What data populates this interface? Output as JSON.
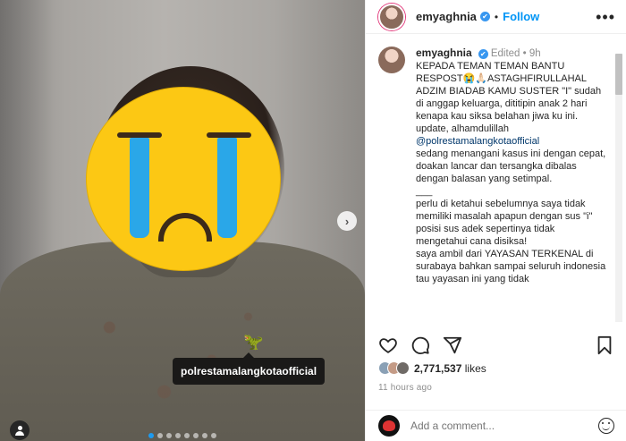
{
  "post": {
    "username": "emyaghnia",
    "follow_label": "Follow",
    "more_label": "•••",
    "separator": "•"
  },
  "caption": {
    "username": "emyaghnia",
    "meta": "Edited • 9h",
    "lines": [
      "KEPADA TEMAN TEMAN BANTU RESPOST😭🙏🏻ASTAGHFIRULLAHAL ADZIM BIADAB KAMU SUSTER \"I\" sudah di anggap keluarga, dititipin anak 2 hari kenapa kau siksa belahan jiwa ku ini.",
      "update, alhamdulillah",
      "@polrestamalangkotaofficial",
      "sedang menangani kasus ini dengan cepat, doakan lancar dan tersangka dibalas dengan balasan yang setimpal.",
      "___",
      "perlu di ketahui sebelumnya saya tidak memiliki masalah apapun dengan sus \"i\" posisi sus adek sepertinya tidak mengetahui cana disiksa!",
      "saya ambil dari YAYASAN TERKENAL di surabaya bahkan sampai seluruh indonesia tau yayasan ini yang tidak"
    ]
  },
  "media": {
    "tag_label": "polrestamalangkotaofficial",
    "next_label": "›",
    "dot_count": 8,
    "active_dot": 0
  },
  "engagement": {
    "likes_count": "2,771,537",
    "likes_suffix": "likes",
    "time_ago": "11 hours ago"
  },
  "comment": {
    "placeholder": "Add a comment..."
  },
  "colors": {
    "follow": "#0095f6",
    "mention": "#00376b",
    "verified": "#3897f0",
    "emoji_yellow": "#fcc814",
    "tear_blue": "#2aa7e8"
  },
  "icons": [
    "heart-icon",
    "comment-icon",
    "share-icon",
    "save-icon",
    "emoji-icon",
    "user-tag-icon",
    "chevron-right-icon",
    "verified-icon"
  ]
}
